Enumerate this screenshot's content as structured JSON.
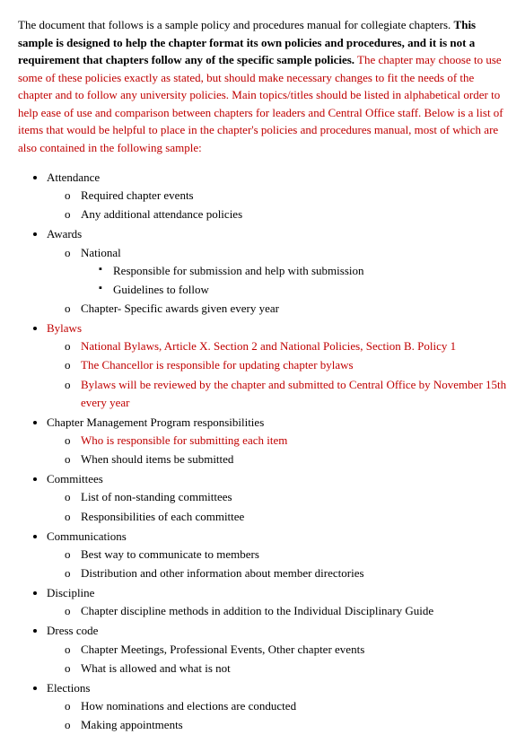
{
  "intro": {
    "part1": "The document that follows is a sample policy and procedures manual for collegiate chapters. ",
    "part2": "This sample is designed to help the chapter format its own policies and procedures, and it is not a requirement that chapters follow any of the specific sample policies.",
    "part3": " The chapter may choose to use some of these policies exactly as stated, but should make necessary changes to fit the needs of the chapter and to follow any university policies. Main topics/titles should be listed in alphabetical order to help ease of use and comparison between chapters for leaders and Central Office staff.  Below is a list of items that would be helpful to place in the chapter's policies and procedures manual, most of which are also contained in the following sample:"
  },
  "list": [
    {
      "label": "Attendance",
      "children": [
        {
          "label": "Required chapter events",
          "children": []
        },
        {
          "label": "Any additional attendance policies",
          "children": []
        }
      ]
    },
    {
      "label": "Awards",
      "children": [
        {
          "label": "National",
          "children": [
            {
              "label": "Responsible for submission and help with submission"
            },
            {
              "label": "Guidelines to follow"
            }
          ]
        },
        {
          "label": "Chapter- Specific awards given every year",
          "children": []
        }
      ]
    },
    {
      "label": "Bylaws",
      "red": true,
      "children": [
        {
          "label": "National Bylaws, Article X. Section 2 and National Policies, Section B. Policy 1",
          "red": true,
          "children": []
        },
        {
          "label": "The Chancellor is responsible for updating chapter bylaws",
          "red": true,
          "children": []
        },
        {
          "label": "Bylaws will be reviewed by the chapter and submitted to Central Office by November 15th every year",
          "red": true,
          "children": []
        }
      ]
    },
    {
      "label": "Chapter Management Program responsibilities",
      "children": [
        {
          "label": "Who is responsible for submitting each item",
          "red": true,
          "children": []
        },
        {
          "label": "When should items be submitted",
          "children": []
        }
      ]
    },
    {
      "label": "Committees",
      "children": [
        {
          "label": "List of non-standing committees",
          "children": []
        },
        {
          "label": "Responsibilities of each committee",
          "children": []
        }
      ]
    },
    {
      "label": "Communications",
      "children": [
        {
          "label": "Best way to communicate to members",
          "children": []
        },
        {
          "label": "Distribution and other information about member directories",
          "children": []
        }
      ]
    },
    {
      "label": "Discipline",
      "children": [
        {
          "label": "Chapter discipline methods in addition to the Individual Disciplinary Guide",
          "children": []
        }
      ]
    },
    {
      "label": "Dress code",
      "children": [
        {
          "label": "Chapter Meetings, Professional Events, Other chapter events",
          "children": []
        },
        {
          "label": "What is allowed and what is not",
          "children": []
        }
      ]
    },
    {
      "label": "Elections",
      "children": [
        {
          "label": "How nominations and elections are conducted",
          "children": []
        },
        {
          "label": "Making appointments",
          "children": []
        }
      ]
    }
  ]
}
